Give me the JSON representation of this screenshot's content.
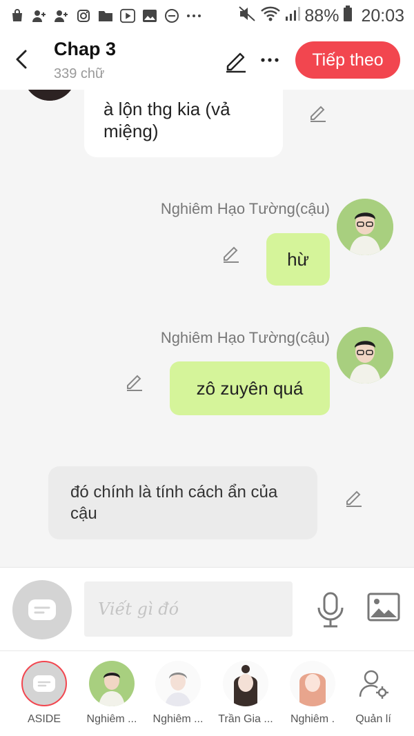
{
  "status_bar": {
    "battery": "88%",
    "time": "20:03"
  },
  "header": {
    "title": "Chap 3",
    "word_count": "339 chữ",
    "next_button": "Tiếp theo"
  },
  "messages": {
    "top_left": "à lộn thg kia (vả miệng)",
    "msg1_sender": "Nghiêm Hạo Tường(cậu)",
    "msg1_text": "hừ",
    "msg2_sender": "Nghiêm Hạo Tường(cậu)",
    "msg2_text": "zô zuyên quá",
    "narration": "đó chính là tính cách ẩn của cậu"
  },
  "input": {
    "placeholder": "Viết gì đó"
  },
  "characters": [
    {
      "label": "ASIDE"
    },
    {
      "label": "Nghiêm ..."
    },
    {
      "label": "Nghiêm ..."
    },
    {
      "label": "Trần Gia ..."
    },
    {
      "label": "Nghiêm ."
    },
    {
      "label": "Quản lí"
    }
  ],
  "colors": {
    "accent": "#f2464f",
    "bubble_green": "#d5f49a"
  }
}
